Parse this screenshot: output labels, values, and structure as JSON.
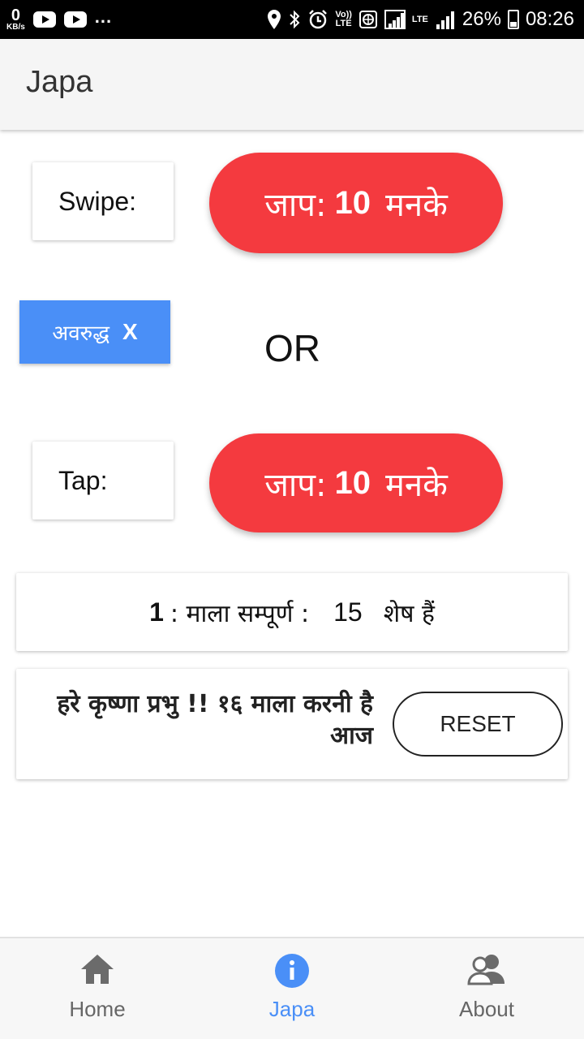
{
  "status_bar": {
    "speed_value": "0",
    "speed_unit": "KB/s",
    "dots": "...",
    "volte_top": "Vo))",
    "volte_bottom": "LTE",
    "lte": "LTE",
    "battery": "26%",
    "time": "08:26"
  },
  "app_bar": {
    "title": "Japa"
  },
  "swipe": {
    "label": "Swipe:",
    "button_prefix": "जाप:",
    "button_count": "10",
    "button_suffix": "मनके"
  },
  "block_button": {
    "label": "अवरुद्ध",
    "close": "X"
  },
  "or_text": "OR",
  "tap": {
    "label": "Tap:",
    "button_prefix": "जाप:",
    "button_count": "10",
    "button_suffix": "मनके"
  },
  "mala_status": {
    "completed": "1",
    "completed_text": ": माला सम्पूर्ण :",
    "remaining": "15",
    "remaining_text": "शेष हैं"
  },
  "message": {
    "text": "हरे कृष्णा प्रभु !! १६ माला करनी है आज",
    "reset_label": "RESET"
  },
  "bottom_nav": {
    "items": [
      {
        "label": "Home",
        "icon": "home-icon"
      },
      {
        "label": "Japa",
        "icon": "info-icon",
        "active": true
      },
      {
        "label": "About",
        "icon": "people-icon"
      }
    ],
    "active_color": "#4a8ff7",
    "inactive_color": "#666666"
  },
  "colors": {
    "accent_red": "#f43a3f",
    "accent_blue": "#4a8ff7"
  }
}
